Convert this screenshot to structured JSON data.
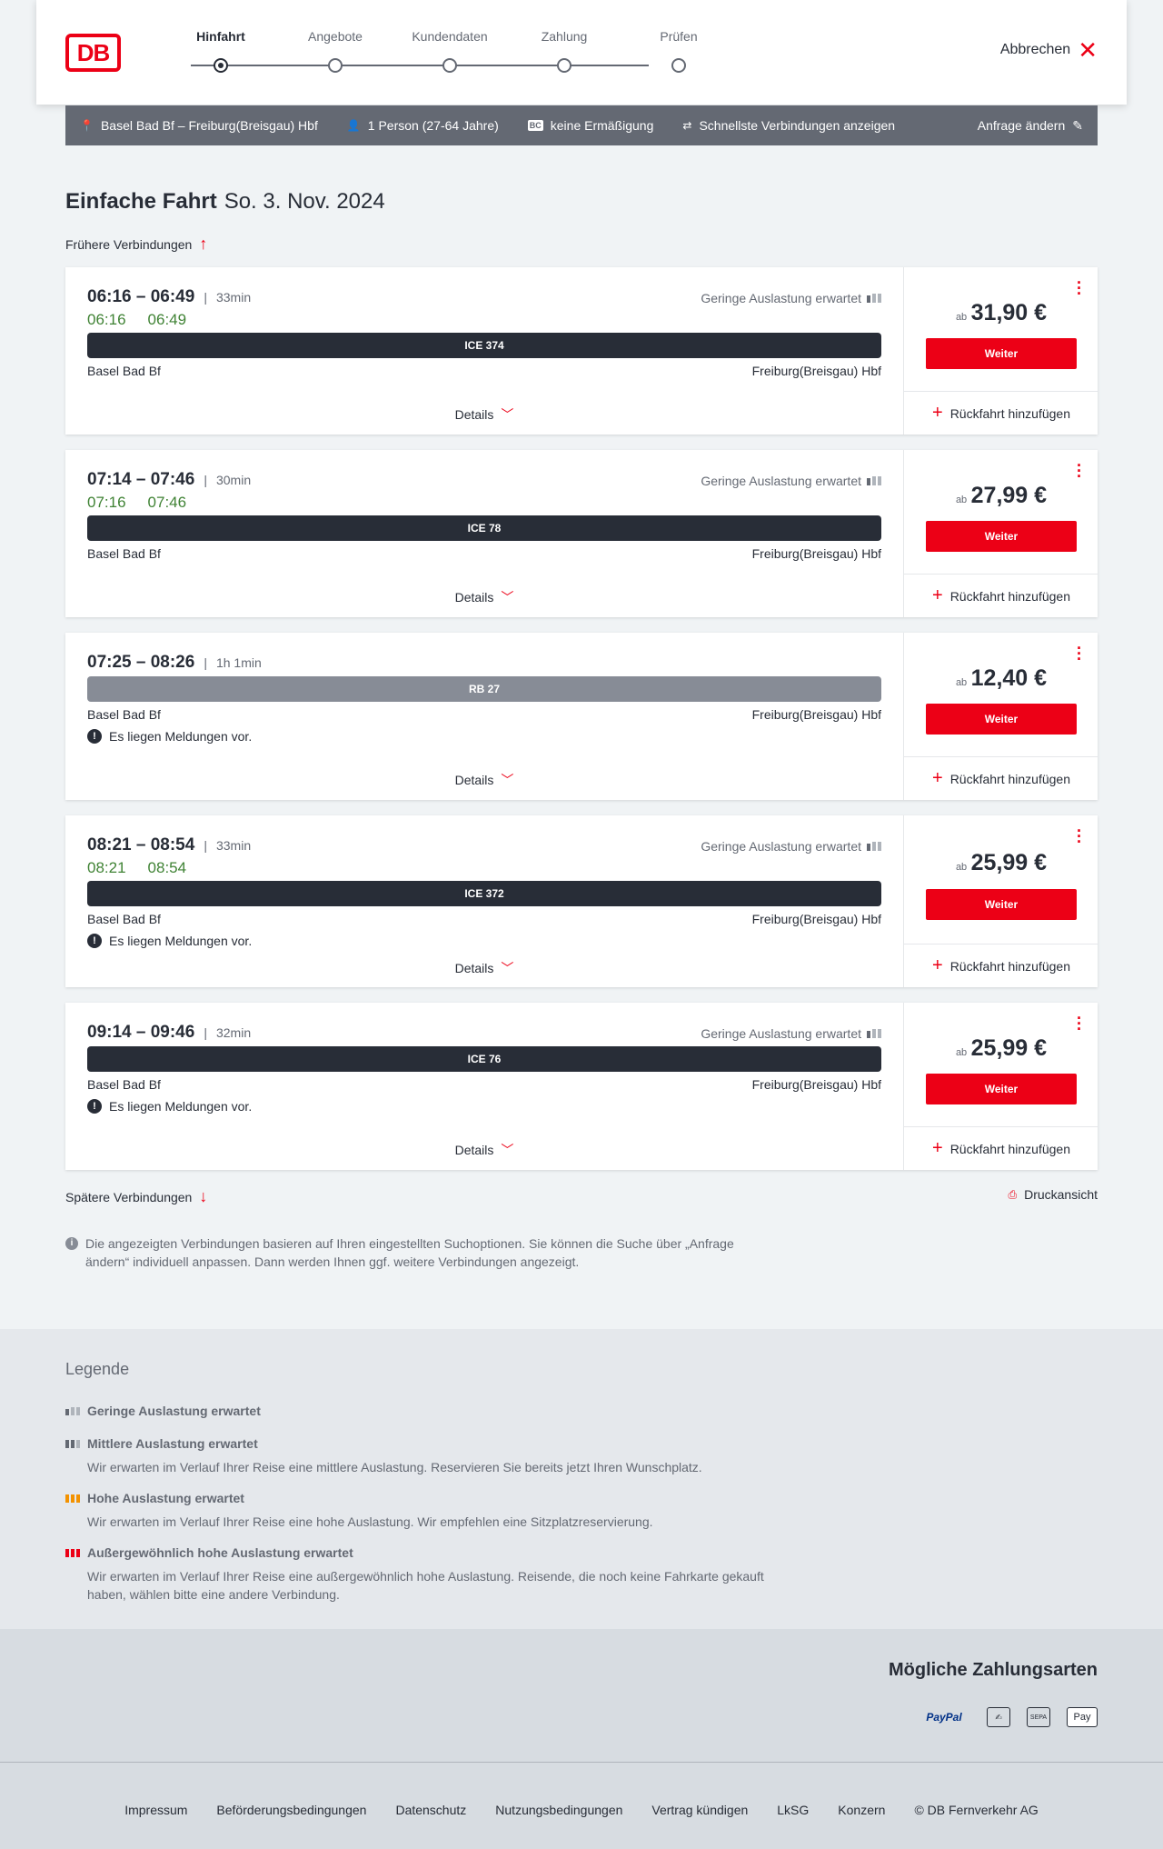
{
  "header": {
    "logo": "DB",
    "steps": [
      "Hinfahrt",
      "Angebote",
      "Kundendaten",
      "Zahlung",
      "Prüfen"
    ],
    "cancel_label": "Abbrechen"
  },
  "search": {
    "route": "Basel Bad Bf – Freiburg(Breisgau) Hbf",
    "passengers": "1 Person (27-64 Jahre)",
    "bc_badge": "BC",
    "discount": "keine Ermäßigung",
    "option": "Schnellste Verbindungen anzeigen",
    "change_label": "Anfrage ändern"
  },
  "title": {
    "trip_type": "Einfache Fahrt",
    "date": "So. 3. Nov. 2024"
  },
  "earlier_label": "Frühere Verbindungen",
  "later_label": "Spätere Verbindungen",
  "print_label": "Druckansicht",
  "connections": [
    {
      "times": "06:16 – 06:49",
      "duration": "33min",
      "rt_dep": "06:16",
      "rt_arr": "06:49",
      "occupancy": "Geringe Auslastung erwartet",
      "train": "ICE 374",
      "from": "Basel Bad Bf",
      "to": "Freiburg(Breisgau) Hbf",
      "message": "",
      "details": "Details",
      "price_prefix": "ab",
      "price": "31,90 €",
      "button": "Weiter",
      "return": "Rückfahrt hinzufügen"
    },
    {
      "times": "07:14 – 07:46",
      "duration": "30min",
      "rt_dep": "07:16",
      "rt_arr": "07:46",
      "occupancy": "Geringe Auslastung erwartet",
      "train": "ICE 78",
      "from": "Basel Bad Bf",
      "to": "Freiburg(Breisgau) Hbf",
      "message": "",
      "details": "Details",
      "price_prefix": "ab",
      "price": "27,99 €",
      "button": "Weiter",
      "return": "Rückfahrt hinzufügen"
    },
    {
      "times": "07:25 – 08:26",
      "duration": "1h 1min",
      "rt_dep": "",
      "rt_arr": "",
      "occupancy": "",
      "train": "RB 27",
      "from": "Basel Bad Bf",
      "to": "Freiburg(Breisgau) Hbf",
      "message": "Es liegen Meldungen vor.",
      "details": "Details",
      "price_prefix": "ab",
      "price": "12,40 €",
      "button": "Weiter",
      "return": "Rückfahrt hinzufügen"
    },
    {
      "times": "08:21 – 08:54",
      "duration": "33min",
      "rt_dep": "08:21",
      "rt_arr": "08:54",
      "occupancy": "Geringe Auslastung erwartet",
      "train": "ICE 372",
      "from": "Basel Bad Bf",
      "to": "Freiburg(Breisgau) Hbf",
      "message": "Es liegen Meldungen vor.",
      "details": "Details",
      "price_prefix": "ab",
      "price": "25,99 €",
      "button": "Weiter",
      "return": "Rückfahrt hinzufügen"
    },
    {
      "times": "09:14 – 09:46",
      "duration": "32min",
      "rt_dep": "",
      "rt_arr": "",
      "occupancy": "Geringe Auslastung erwartet",
      "train": "ICE 76",
      "from": "Basel Bad Bf",
      "to": "Freiburg(Breisgau) Hbf",
      "message": "Es liegen Meldungen vor.",
      "details": "Details",
      "price_prefix": "ab",
      "price": "25,99 €",
      "button": "Weiter",
      "return": "Rückfahrt hinzufügen"
    }
  ],
  "info_note": "Die angezeigten Verbindungen basieren auf Ihren eingestellten Suchoptionen. Sie können die Suche über „Anfrage ändern“ individuell anpassen. Dann werden Ihnen ggf. weitere Verbindungen angezeigt.",
  "legend": {
    "title": "Legende",
    "items": [
      {
        "title": "Geringe Auslastung erwartet",
        "desc": ""
      },
      {
        "title": "Mittlere Auslastung erwartet",
        "desc": "Wir erwarten im Verlauf Ihrer Reise eine mittlere Auslastung. Reservieren Sie bereits jetzt Ihren Wunschplatz."
      },
      {
        "title": "Hohe Auslastung erwartet",
        "desc": "Wir erwarten im Verlauf Ihrer Reise eine hohe Auslastung. Wir empfehlen eine Sitzplatzreservierung."
      },
      {
        "title": "Außergewöhnlich hohe Auslastung erwartet",
        "desc": "Wir erwarten im Verlauf Ihrer Reise eine außergewöhnlich hohe Auslastung. Reisende, die noch keine Fahrkarte gekauft haben, wählen bitte eine andere Verbindung."
      }
    ]
  },
  "payments": {
    "title": "Mögliche Zahlungsarten",
    "paypal": "PayPal",
    "card": "✍",
    "sepa": "SEPA",
    "applepay": "Pay"
  },
  "footer": {
    "links": [
      "Impressum",
      "Beförderungsbedingungen",
      "Datenschutz",
      "Nutzungsbedingungen",
      "Vertrag kündigen",
      "LkSG",
      "Konzern"
    ],
    "copyright": "© DB Fernverkehr AG"
  },
  "colors": {
    "brand_red": "#ec0016",
    "realtime_green": "#408335",
    "dark": "#282d37",
    "searchbar_bg": "#646973"
  }
}
